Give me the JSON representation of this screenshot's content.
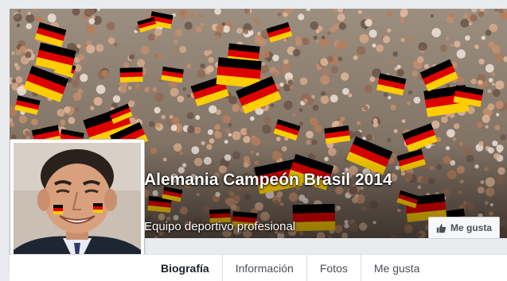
{
  "page": {
    "name": "Alemania Campeón Brasil 2014",
    "category": "Equipo deportivo profesional"
  },
  "actions": {
    "like_label": "Me gusta",
    "like_icon": "thumbs-up-icon"
  },
  "tabs": [
    {
      "label": "Biografía",
      "active": true
    },
    {
      "label": "Información",
      "active": false
    },
    {
      "label": "Fotos",
      "active": false
    },
    {
      "label": "Me gusta",
      "active": false
    }
  ],
  "colors": {
    "flag_black": "#000000",
    "flag_red": "#dd0000",
    "flag_gold": "#ffce00",
    "tab_border": "#dddfe2",
    "text_dark": "#1d2129"
  }
}
